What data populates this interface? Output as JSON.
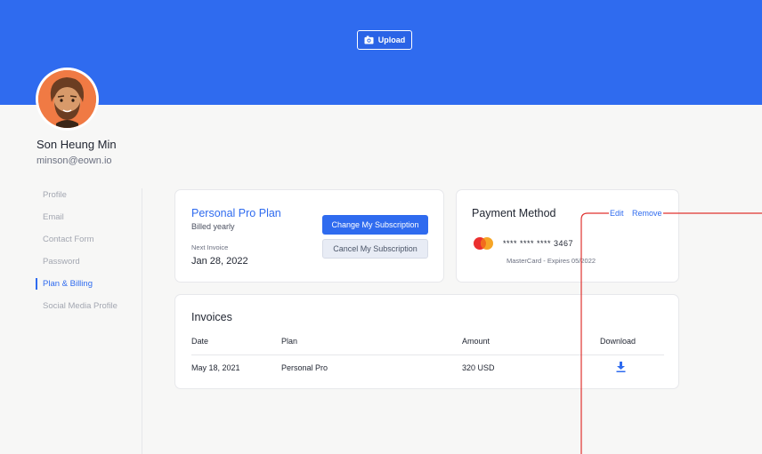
{
  "header": {
    "upload_label": "Upload",
    "banner_color": "#2f6bef"
  },
  "profile": {
    "name": "Son Heung Min",
    "email": "minson@eown.io"
  },
  "sidebar": {
    "items": [
      {
        "label": "Profile",
        "active": false
      },
      {
        "label": "Email",
        "active": false
      },
      {
        "label": "Contact Form",
        "active": false
      },
      {
        "label": "Password",
        "active": false
      },
      {
        "label": "Plan & Billing",
        "active": true
      },
      {
        "label": "Social Media Profile",
        "active": false
      }
    ]
  },
  "plan": {
    "title": "Personal Pro Plan",
    "billing": "Billed yearly",
    "next_invoice_label": "Next Invoice",
    "next_invoice_date": "Jan 28, 2022",
    "change_label": "Change My Subscription",
    "cancel_label": "Cancel My Subscription"
  },
  "payment": {
    "title": "Payment Method",
    "edit_label": "Edit",
    "remove_label": "Remove",
    "card_number": "**** **** **** 3467",
    "expiry": "MasterCard - Expires 05/2022",
    "card_icon": "mastercard-icon"
  },
  "invoices": {
    "title": "Invoices",
    "columns": [
      "Date",
      "Plan",
      "Amount",
      "Download"
    ],
    "rows": [
      {
        "date": "May 18, 2021",
        "plan": "Personal Pro",
        "amount": "320 USD",
        "download_icon": "download-icon"
      }
    ]
  },
  "colors": {
    "accent": "#2f6bef",
    "annotation": "#e0322f"
  }
}
